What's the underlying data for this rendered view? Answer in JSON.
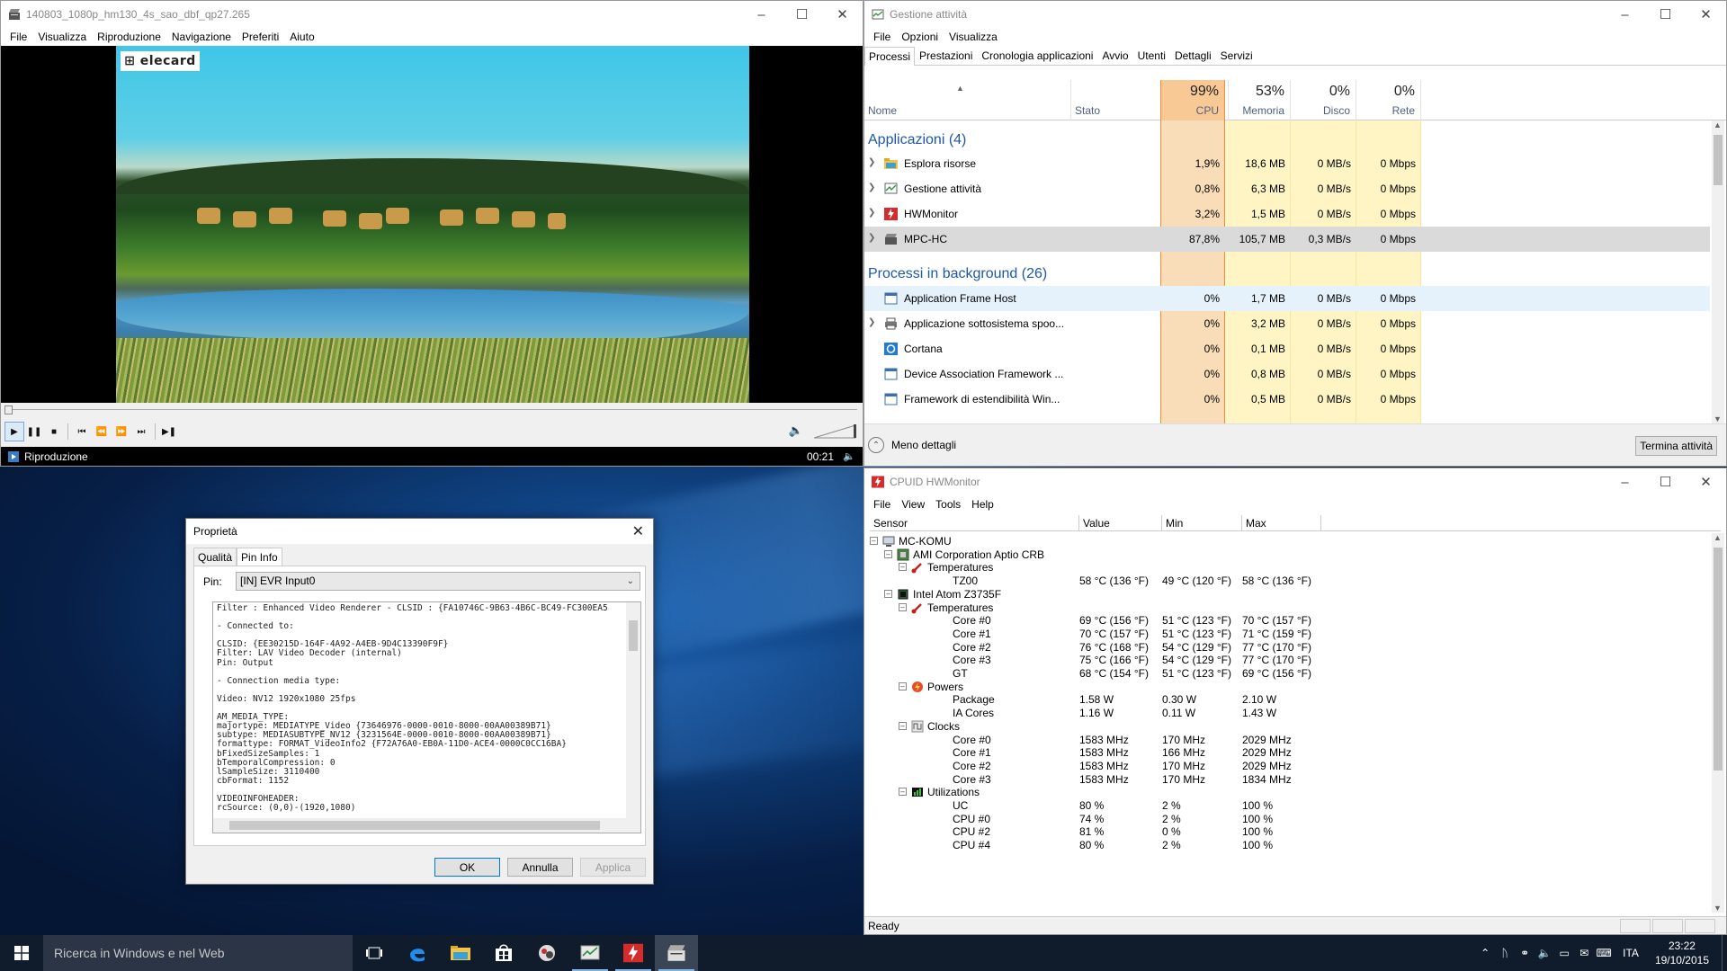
{
  "mpc": {
    "title": "140803_1080p_hm130_4s_sao_dbf_qp27.265",
    "menu": [
      "File",
      "Visualizza",
      "Riproduzione",
      "Navigazione",
      "Preferiti",
      "Aiuto"
    ],
    "logo_text": "⊞ elecard",
    "status": "Riproduzione",
    "time": "00:21",
    "seek_position_fraction": 0.0
  },
  "taskmgr": {
    "title": "Gestione attività",
    "menu": [
      "File",
      "Opzioni",
      "Visualizza"
    ],
    "tabs": [
      "Processi",
      "Prestazioni",
      "Cronologia applicazioni",
      "Avvio",
      "Utenti",
      "Dettagli",
      "Servizi"
    ],
    "columns": {
      "name": "Nome",
      "state": "Stato",
      "cpu_pct": "99%",
      "cpu": "CPU",
      "mem_pct": "53%",
      "mem": "Memoria",
      "disk_pct": "0%",
      "disk": "Disco",
      "net_pct": "0%",
      "net": "Rete"
    },
    "group_apps": "Applicazioni (4)",
    "group_bg": "Processi in background (26)",
    "apps": [
      {
        "name": "Esplora risorse",
        "cpu": "1,9%",
        "mem": "18,6 MB",
        "disk": "0 MB/s",
        "net": "0 Mbps"
      },
      {
        "name": "Gestione attività",
        "cpu": "0,8%",
        "mem": "6,3 MB",
        "disk": "0 MB/s",
        "net": "0 Mbps"
      },
      {
        "name": "HWMonitor",
        "cpu": "3,2%",
        "mem": "1,5 MB",
        "disk": "0 MB/s",
        "net": "0 Mbps"
      },
      {
        "name": "MPC-HC",
        "cpu": "87,8%",
        "mem": "105,7 MB",
        "disk": "0,3 MB/s",
        "net": "0 Mbps"
      }
    ],
    "bg": [
      {
        "name": "Application Frame Host",
        "cpu": "0%",
        "mem": "1,7 MB",
        "disk": "0 MB/s",
        "net": "0 Mbps"
      },
      {
        "name": "Applicazione sottosistema spoo...",
        "cpu": "0%",
        "mem": "3,2 MB",
        "disk": "0 MB/s",
        "net": "0 Mbps"
      },
      {
        "name": "Cortana",
        "cpu": "0%",
        "mem": "0,1 MB",
        "disk": "0 MB/s",
        "net": "0 Mbps"
      },
      {
        "name": "Device Association Framework ...",
        "cpu": "0%",
        "mem": "0,8 MB",
        "disk": "0 MB/s",
        "net": "0 Mbps"
      },
      {
        "name": "Framework di estendibilità Win...",
        "cpu": "0%",
        "mem": "0,5 MB",
        "disk": "0 MB/s",
        "net": "0 Mbps"
      }
    ],
    "fewer_details": "Meno dettagli",
    "end_task": "Termina attività",
    "colors": {
      "cpu_heat": "#f9c995",
      "heat": "#fff4c4",
      "cpu_border": "#f08c3a",
      "group": "#1e57a8"
    }
  },
  "hwmon": {
    "title": "CPUID HWMonitor",
    "menu": [
      "File",
      "View",
      "Tools",
      "Help"
    ],
    "columns": [
      "Sensor",
      "Value",
      "Min",
      "Max"
    ],
    "status": "Ready",
    "rows": [
      {
        "level": 0,
        "box": "-",
        "icon": "computer",
        "label": "MC-KOMU"
      },
      {
        "level": 1,
        "box": "-",
        "icon": "board",
        "label": "AMI Corporation Aptio CRB"
      },
      {
        "level": 2,
        "box": "-",
        "icon": "thermo",
        "label": "Temperatures"
      },
      {
        "level": 3,
        "label": "TZ00",
        "value": "58 °C  (136 °F)",
        "min": "49 °C  (120 °F)",
        "max": "58 °C  (136 °F)"
      },
      {
        "level": 1,
        "box": "-",
        "icon": "chip",
        "label": "Intel Atom Z3735F"
      },
      {
        "level": 2,
        "box": "-",
        "icon": "thermo",
        "label": "Temperatures"
      },
      {
        "level": 3,
        "label": "Core #0",
        "value": "69 °C  (156 °F)",
        "min": "51 °C  (123 °F)",
        "max": "70 °C  (157 °F)"
      },
      {
        "level": 3,
        "label": "Core #1",
        "value": "70 °C  (157 °F)",
        "min": "51 °C  (123 °F)",
        "max": "71 °C  (159 °F)"
      },
      {
        "level": 3,
        "label": "Core #2",
        "value": "76 °C  (168 °F)",
        "min": "54 °C  (129 °F)",
        "max": "77 °C  (170 °F)"
      },
      {
        "level": 3,
        "label": "Core #3",
        "value": "75 °C  (166 °F)",
        "min": "54 °C  (129 °F)",
        "max": "77 °C  (170 °F)"
      },
      {
        "level": 3,
        "label": "GT",
        "value": "68 °C  (154 °F)",
        "min": "51 °C  (123 °F)",
        "max": "69 °C  (156 °F)"
      },
      {
        "level": 2,
        "box": "-",
        "icon": "power",
        "label": "Powers"
      },
      {
        "level": 3,
        "label": "Package",
        "value": "1.58 W",
        "min": "0.30 W",
        "max": "2.10 W"
      },
      {
        "level": 3,
        "label": "IA Cores",
        "value": "1.16 W",
        "min": "0.11 W",
        "max": "1.43 W"
      },
      {
        "level": 2,
        "box": "-",
        "icon": "clock",
        "label": "Clocks"
      },
      {
        "level": 3,
        "label": "Core #0",
        "value": "1583 MHz",
        "min": "170 MHz",
        "max": "2029 MHz"
      },
      {
        "level": 3,
        "label": "Core #1",
        "value": "1583 MHz",
        "min": "166 MHz",
        "max": "2029 MHz"
      },
      {
        "level": 3,
        "label": "Core #2",
        "value": "1583 MHz",
        "min": "170 MHz",
        "max": "2029 MHz"
      },
      {
        "level": 3,
        "label": "Core #3",
        "value": "1583 MHz",
        "min": "170 MHz",
        "max": "1834 MHz"
      },
      {
        "level": 2,
        "box": "-",
        "icon": "util",
        "label": "Utilizations"
      },
      {
        "level": 3,
        "label": "UC",
        "value": "80 %",
        "min": "2 %",
        "max": "100 %"
      },
      {
        "level": 3,
        "label": "CPU #0",
        "value": "74 %",
        "min": "2 %",
        "max": "100 %"
      },
      {
        "level": 3,
        "label": "CPU #2",
        "value": "81 %",
        "min": "0 %",
        "max": "100 %"
      },
      {
        "level": 3,
        "label": "CPU #4",
        "value": "80 %",
        "min": "2 %",
        "max": "100 %"
      }
    ]
  },
  "dialog": {
    "title": "Proprietà",
    "tabs": [
      "Qualità",
      "Pin Info"
    ],
    "pin_label": "Pin:",
    "pin_value": "[IN] EVR Input0",
    "info_lines": [
      "Filter : Enhanced Video Renderer - CLSID : {FA10746C-9B63-4B6C-BC49-FC300EA5",
      "",
      "- Connected to:",
      "",
      "CLSID: {EE30215D-164F-4A92-A4EB-9D4C13390F9F}",
      "Filter: LAV Video Decoder (internal)",
      "Pin: Output",
      "",
      "- Connection media type:",
      "",
      "Video: NV12 1920x1080 25fps",
      "",
      "AM_MEDIA_TYPE:",
      "majortype: MEDIATYPE_Video {73646976-0000-0010-8000-00AA00389B71}",
      "subtype: MEDIASUBTYPE_NV12 {3231564E-0000-0010-8000-00AA00389B71}",
      "formattype: FORMAT_VideoInfo2 {F72A76A0-EB0A-11D0-ACE4-0000C0CC16BA}",
      "bFixedSizeSamples: 1",
      "bTemporalCompression: 0",
      "lSampleSize: 3110400",
      "cbFormat: 1152",
      "",
      "VIDEOINFOHEADER:",
      "rcSource: (0,0)-(1920,1080)"
    ],
    "buttons": {
      "ok": "OK",
      "cancel": "Annulla",
      "apply": "Applica"
    }
  },
  "taskbar": {
    "search_placeholder": "Ricerca in Windows e nel Web",
    "lang": "ITA",
    "time": "23:22",
    "date": "19/10/2015",
    "accent": "#7fb3e8"
  }
}
